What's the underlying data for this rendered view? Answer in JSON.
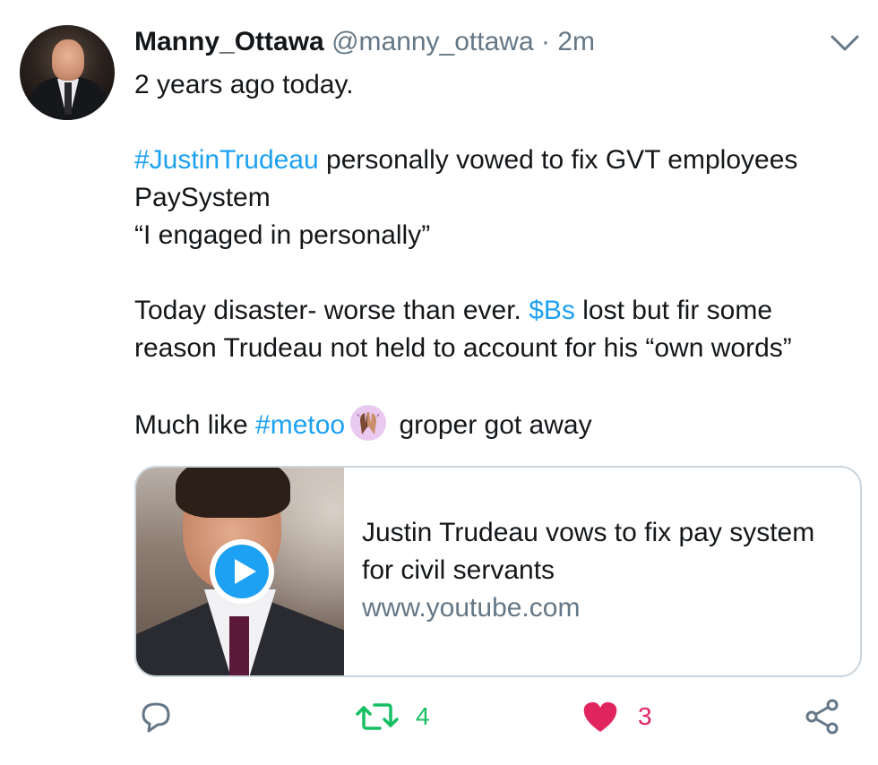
{
  "author": {
    "name": "Manny_Ottawa",
    "handle": "@manny_ottawa",
    "separator": "·",
    "time": "2m"
  },
  "tweet": {
    "line1": "2 years ago today.",
    "hashtag1": "#JustinTrudeau",
    "line2_rest": " personally vowed to fix GVT employees",
    "line3": "PaySystem",
    "line4": "“I engaged in personally”",
    "line5_pre": "Today disaster- worse than ever. ",
    "cashtag": "$Bs",
    "line5_post": " lost but fir some",
    "line6": "reason Trudeau not held to account for his “own words”",
    "line7_pre": "Much like ",
    "hashtag2": "#metoo",
    "line7_post": " groper got away"
  },
  "card": {
    "title": "Justin Trudeau vows to fix pay system for civil servants",
    "domain": "www.youtube.com"
  },
  "actions": {
    "retweet_count": "4",
    "like_count": "3"
  },
  "colors": {
    "link": "#1da1f2",
    "secondary": "#657786",
    "retweet": "#17bf63",
    "like": "#e0245e",
    "emoji_bg": "#e9c9ef"
  },
  "icons": {
    "menu": "chevron-down-icon",
    "reply": "reply-icon",
    "retweet": "retweet-icon",
    "like": "heart-icon",
    "share": "share-icon",
    "play": "play-icon",
    "emoji": "raising-hands-emoji"
  }
}
